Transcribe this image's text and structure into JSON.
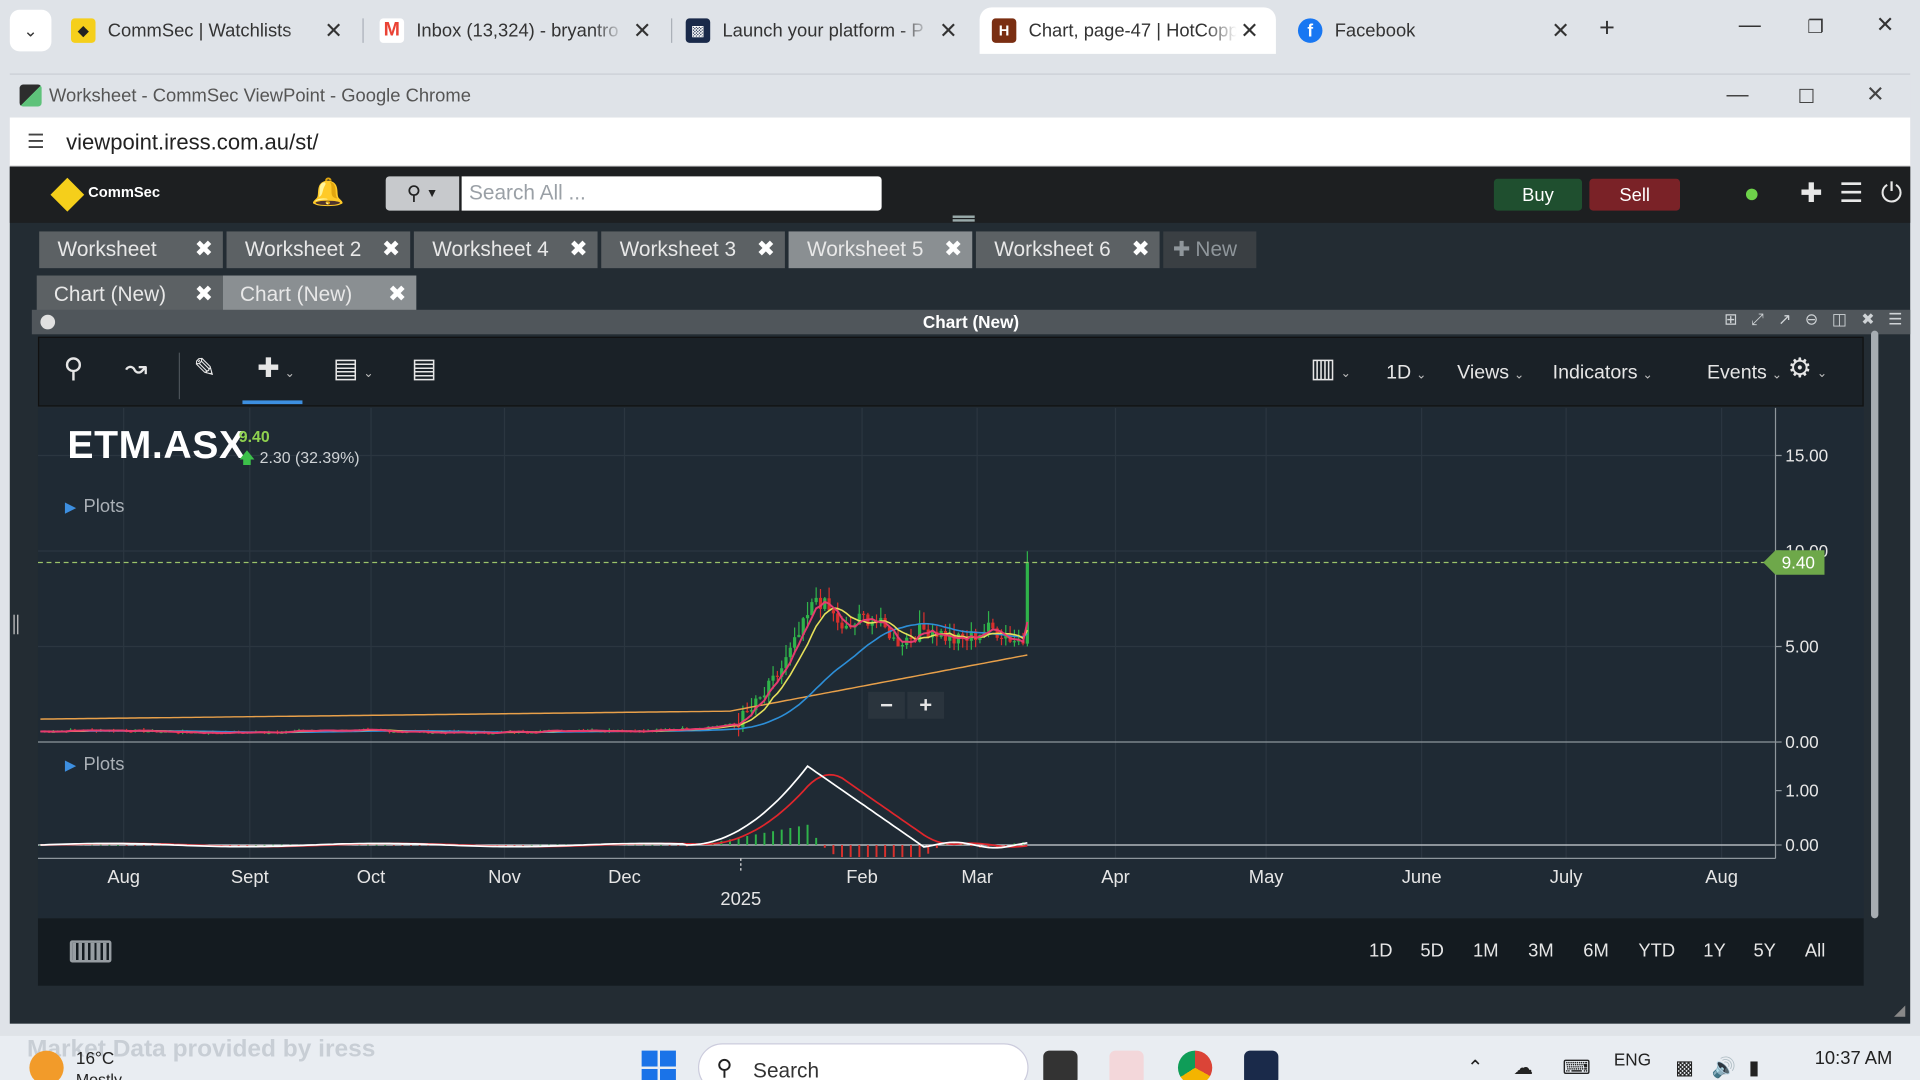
{
  "browser_tabs": [
    {
      "title": "CommSec | Watchlists",
      "fav": "commsec-icon",
      "color": "#f5cf1b"
    },
    {
      "title": "Inbox (13,324) - bryantro",
      "fav": "gmail-icon",
      "color": "#ea4335"
    },
    {
      "title": "Launch your platform - P",
      "fav": "platform-icon",
      "color": "#1a2a4a"
    },
    {
      "title": "Chart, page-47 | HotCopp",
      "fav": "hotcopper-icon",
      "color": "#7a2e12"
    },
    {
      "title": "Facebook",
      "fav": "facebook-icon",
      "color": "#1877f2"
    }
  ],
  "popup": {
    "title": "Worksheet - CommSec ViewPoint - Google Chrome",
    "url": "viewpoint.iress.com.au/st/"
  },
  "header": {
    "logo_text": "CommSec",
    "search_placeholder": "Search All ...",
    "buy_label": "Buy",
    "sell_label": "Sell"
  },
  "worksheet_tabs": [
    "Worksheet",
    "Worksheet 2",
    "Worksheet 4",
    "Worksheet 3",
    "Worksheet 5",
    "Worksheet 6"
  ],
  "worksheet_active": 4,
  "new_tab_label": "New",
  "chart_tabs": [
    "Chart (New)",
    "Chart (New)"
  ],
  "panel_title": "Chart (New)",
  "toolbar": {
    "interval_label": "1D",
    "views_label": "Views",
    "indicators_label": "Indicators",
    "events_label": "Events"
  },
  "chart_header": {
    "symbol": "ETM.ASX",
    "last": "9.40",
    "change": "2.30 (32.39%)",
    "plots_label": "Plots"
  },
  "chart_data": {
    "type": "candlestick",
    "price_ticks": [
      "15.00",
      "10.00",
      "5.00",
      "0.00"
    ],
    "indicator_ticks": [
      "1.00",
      "0.00"
    ],
    "x_labels": [
      "Aug",
      "Sept",
      "Oct",
      "Nov",
      "Dec",
      "Feb",
      "Mar",
      "Apr",
      "May",
      "June",
      "July",
      "Aug"
    ],
    "year_label": "2025",
    "last_price_tag": "9.40",
    "last_price": 9.4,
    "ylim": [
      0,
      17.5
    ],
    "indicator_ylim": [
      -0.2,
      1.6
    ],
    "colors": {
      "up": "#2fb34a",
      "down": "#d9302c",
      "ma_fast": "#e63b6f",
      "ma_mid": "#e6e05a",
      "ma_slow": "#2d8fd8",
      "ma_long": "#e8a04a",
      "macd": "#ffffff",
      "signal": "#e0262c"
    }
  },
  "ranges": [
    "1D",
    "5D",
    "1M",
    "3M",
    "6M",
    "YTD",
    "1Y",
    "5Y",
    "All"
  ],
  "taskbar": {
    "watermark": "Market Data provided by iress",
    "temp": "16°C",
    "condition": "Mostly",
    "search_label": "Search",
    "lang": "ENG",
    "time": "10:37 AM"
  }
}
